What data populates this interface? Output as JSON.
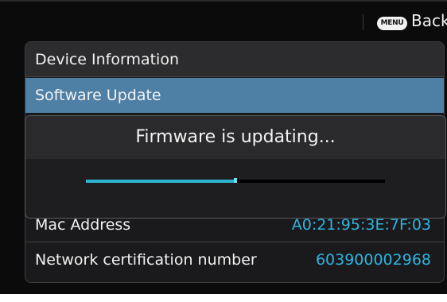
{
  "topbar": {
    "menu_button_label": "MENU",
    "back_label": "Back"
  },
  "menu": {
    "items": [
      {
        "label": "Device Information"
      },
      {
        "label": "Software Update",
        "selected": true
      },
      {
        "label": "Mac Address",
        "value": "A0:21:95:3E:7F:03"
      },
      {
        "label": "Network certification number",
        "value": "603900002968"
      }
    ]
  },
  "dialog": {
    "message": "Firmware is updating...",
    "progress_fraction": 0.5
  },
  "colors": {
    "selected_row": "#4e7fa4",
    "value_text": "#2fb4e0",
    "progress": "#2fb4d2"
  }
}
